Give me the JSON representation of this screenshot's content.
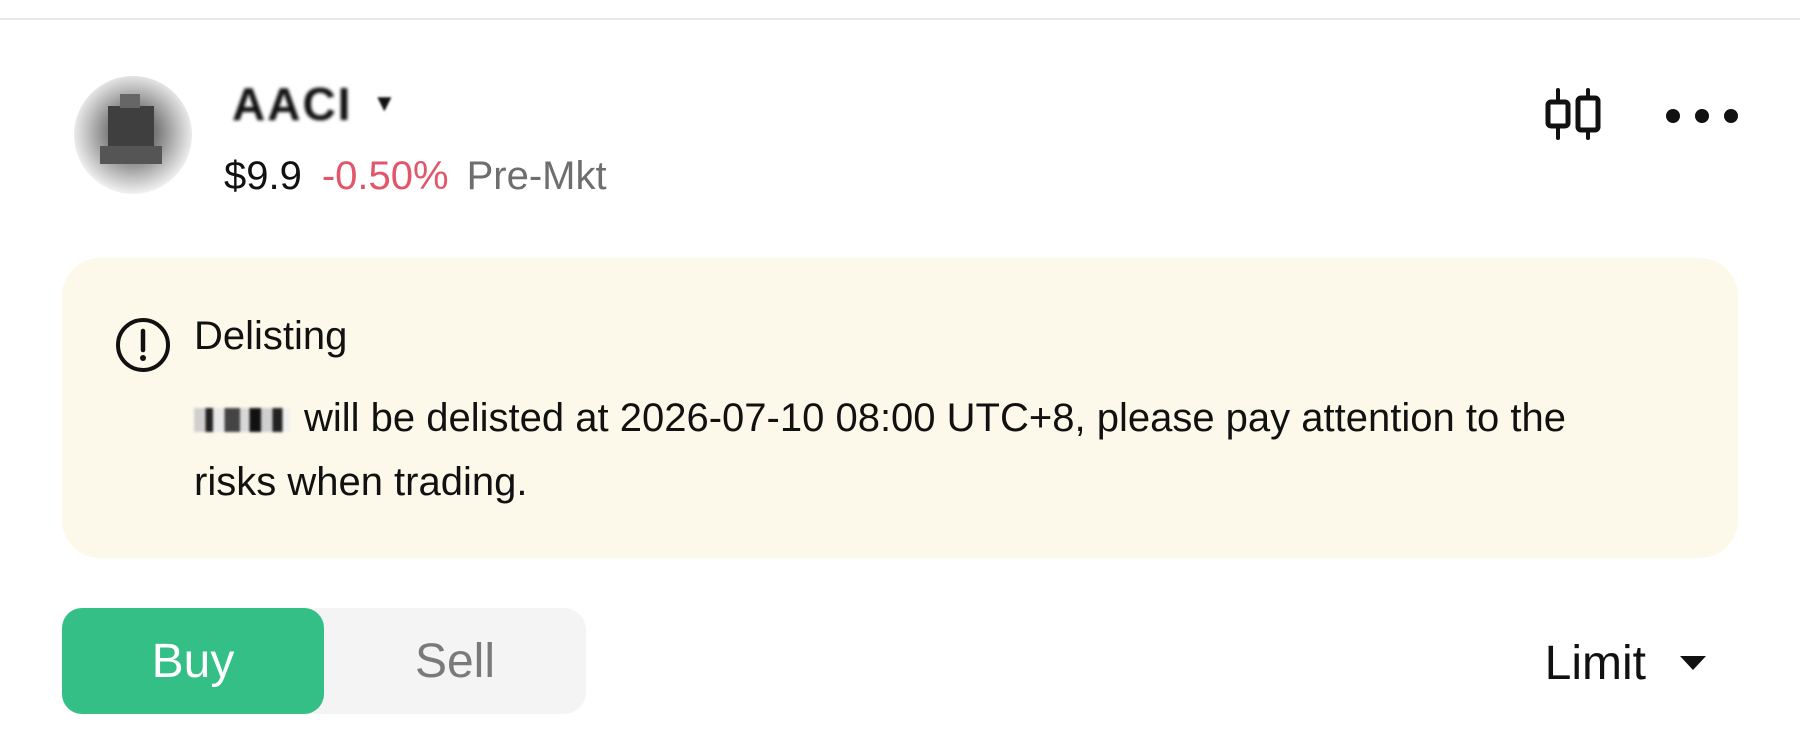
{
  "header": {
    "ticker": "AACI",
    "price": "$9.9",
    "change_pct": "-0.50%",
    "session": "Pre-Mkt"
  },
  "icons": {
    "chart": "candlestick-chart-icon",
    "more": "more-options-icon",
    "alert": "exclamation-circle-icon",
    "dropdown": "caret-down-icon"
  },
  "notice": {
    "title": "Delisting",
    "message": "will be delisted at 2026-07-10 08:00 UTC+8, please pay attention to the risks when trading."
  },
  "trade": {
    "buy_label": "Buy",
    "sell_label": "Sell",
    "selected_side": "Buy",
    "order_type": "Limit"
  },
  "colors": {
    "negative": "#e2566a",
    "buy": "#33bf86",
    "notice_bg": "#fdf9ea",
    "segment_bg": "#f4f4f4"
  }
}
